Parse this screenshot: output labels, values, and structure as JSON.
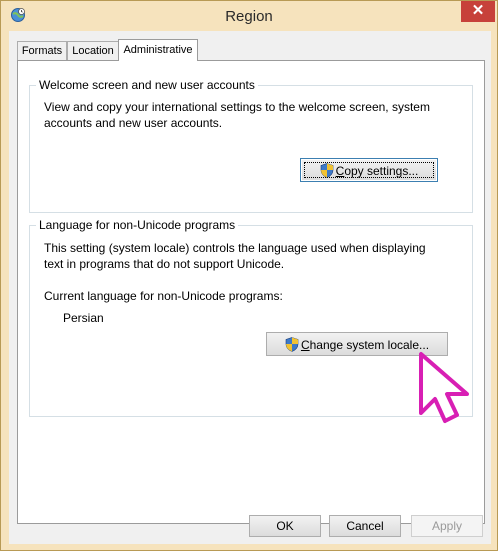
{
  "window": {
    "title": "Region",
    "close_glyph": "✕"
  },
  "tabs": [
    {
      "label": "Formats"
    },
    {
      "label": "Location"
    },
    {
      "label": "Administrative",
      "selected": true
    }
  ],
  "welcome_group": {
    "title": "Welcome screen and new user accounts",
    "description_line1": "View and copy your international settings to the welcome screen, system",
    "description_line2": "accounts and new user accounts.",
    "copy_button": {
      "accel": "C",
      "rest": "opy settings..."
    }
  },
  "locale_group": {
    "title": "Language for non-Unicode programs",
    "description_line1": "This setting (system locale) controls the language used when displaying",
    "description_line2": "text in programs that do not support Unicode.",
    "current_label": "Current language for non-Unicode programs:",
    "current_value": "Persian",
    "change_button": {
      "accel": "C",
      "rest": "hange system locale..."
    }
  },
  "footer": {
    "ok": "OK",
    "cancel": "Cancel",
    "apply": "Apply"
  },
  "icons": {
    "app": "globe-clock-icon",
    "uac": "uac-shield-icon",
    "cursor": "arrow-cursor-icon"
  },
  "colors": {
    "title_bar": "#f6e3bd",
    "close": "#c7413a",
    "cursor": "#d81fb4"
  }
}
